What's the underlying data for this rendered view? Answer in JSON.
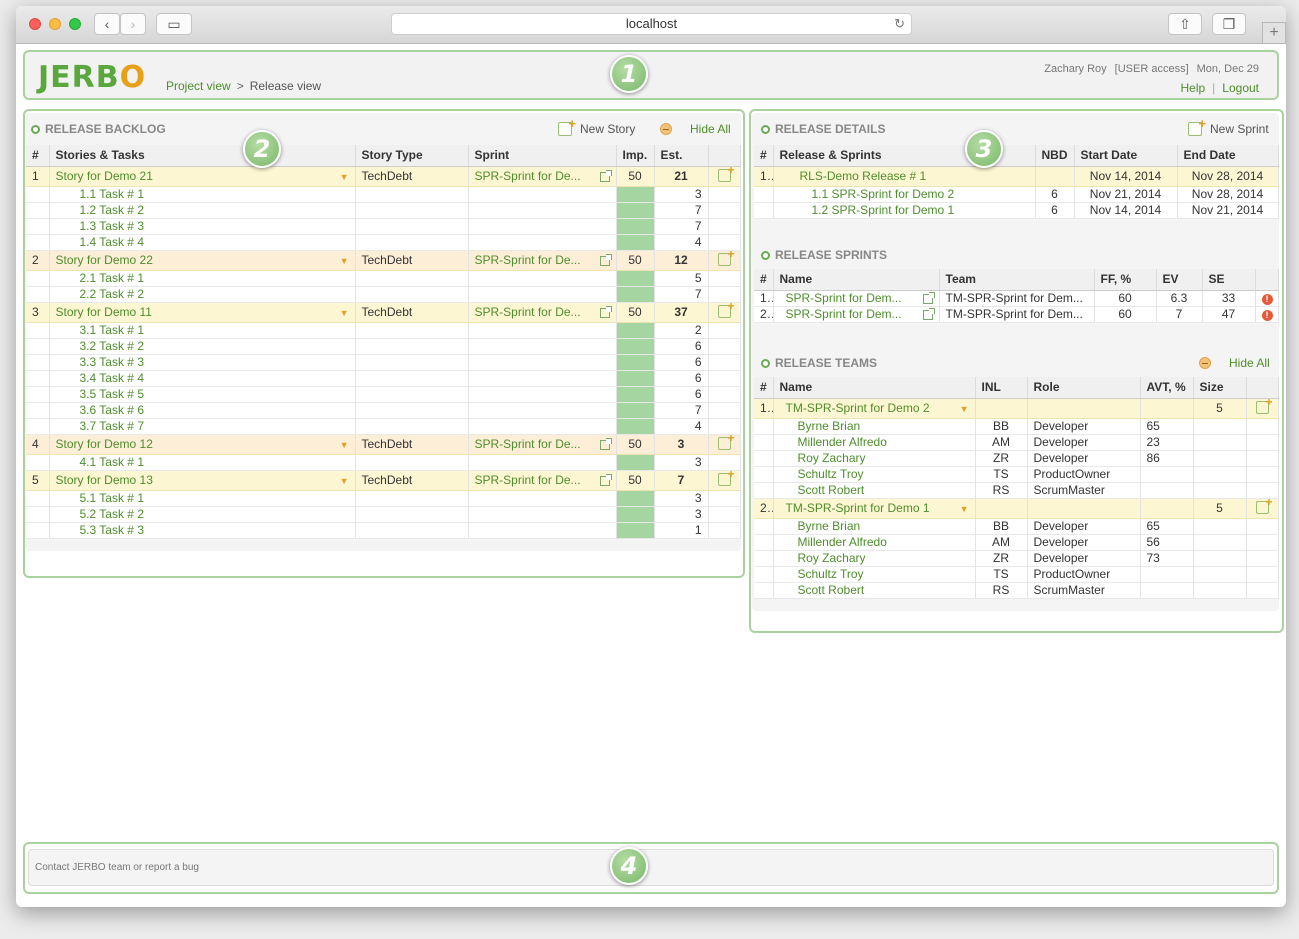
{
  "browser": {
    "url": "localhost"
  },
  "header": {
    "logo": [
      "JERB",
      "O"
    ],
    "crumbs": [
      "Project view",
      "Release view"
    ],
    "crumb_sep": ">",
    "user": "Zachary Roy",
    "access": "[USER access]",
    "date": "Mon, Dec 29",
    "help": "Help",
    "link_sep": "|",
    "logout": "Logout"
  },
  "badges": [
    "1",
    "2",
    "3",
    "4"
  ],
  "backlog": {
    "title": "RELEASE BACKLOG",
    "new_story": "New Story",
    "hide_all": "Hide All",
    "columns": [
      "#",
      "Stories & Tasks",
      "Story Type",
      "Sprint",
      "Imp.",
      "Est."
    ],
    "stories": [
      {
        "n": "1",
        "name": "Story for Demo 21",
        "type": "TechDebt",
        "sprint": "SPR-Sprint for De...",
        "imp": "50",
        "est": "21",
        "tasks": [
          {
            "name": "1.1 Task # 1",
            "est": "3"
          },
          {
            "name": "1.2 Task # 2",
            "est": "7"
          },
          {
            "name": "1.3 Task # 3",
            "est": "7"
          },
          {
            "name": "1.4 Task # 4",
            "est": "4"
          }
        ]
      },
      {
        "n": "2",
        "name": "Story for Demo 22",
        "type": "TechDebt",
        "sprint": "SPR-Sprint for De...",
        "imp": "50",
        "est": "12",
        "tasks": [
          {
            "name": "2.1 Task # 1",
            "est": "5"
          },
          {
            "name": "2.2 Task # 2",
            "est": "7"
          }
        ]
      },
      {
        "n": "3",
        "name": "Story for Demo 11",
        "type": "TechDebt",
        "sprint": "SPR-Sprint for De...",
        "imp": "50",
        "est": "37",
        "tasks": [
          {
            "name": "3.1 Task # 1",
            "est": "2"
          },
          {
            "name": "3.2 Task # 2",
            "est": "6"
          },
          {
            "name": "3.3 Task # 3",
            "est": "6"
          },
          {
            "name": "3.4 Task # 4",
            "est": "6"
          },
          {
            "name": "3.5 Task # 5",
            "est": "6"
          },
          {
            "name": "3.6 Task # 6",
            "est": "7"
          },
          {
            "name": "3.7 Task # 7",
            "est": "4"
          }
        ]
      },
      {
        "n": "4",
        "name": "Story for Demo 12",
        "type": "TechDebt",
        "sprint": "SPR-Sprint for De...",
        "imp": "50",
        "est": "3",
        "tasks": [
          {
            "name": "4.1 Task # 1",
            "est": "3"
          }
        ]
      },
      {
        "n": "5",
        "name": "Story for Demo 13",
        "type": "TechDebt",
        "sprint": "SPR-Sprint for De...",
        "imp": "50",
        "est": "7",
        "tasks": [
          {
            "name": "5.1 Task # 1",
            "est": "3"
          },
          {
            "name": "5.2 Task # 2",
            "est": "3"
          },
          {
            "name": "5.3 Task # 3",
            "est": "1"
          }
        ]
      }
    ]
  },
  "details": {
    "title": "RELEASE DETAILS",
    "new_sprint": "New Sprint",
    "columns": [
      "#",
      "Release & Sprints",
      "NBD",
      "Start Date",
      "End Date"
    ],
    "release": {
      "n": "1",
      "name": "RLS-Demo Release # 1",
      "nbd": "",
      "start": "Nov 14, 2014",
      "end": "Nov 28, 2014"
    },
    "sprints": [
      {
        "name": "1.1  SPR-Sprint for Demo 2",
        "nbd": "6",
        "start": "Nov 21, 2014",
        "end": "Nov 28, 2014"
      },
      {
        "name": "1.2  SPR-Sprint for Demo 1",
        "nbd": "6",
        "start": "Nov 14, 2014",
        "end": "Nov 21, 2014"
      }
    ]
  },
  "sprints": {
    "title": "RELEASE SPRINTS",
    "columns": [
      "#",
      "Name",
      "Team",
      "FF, %",
      "EV",
      "SE"
    ],
    "rows": [
      {
        "n": "1",
        "name": "SPR-Sprint for Dem...",
        "team": "TM-SPR-Sprint for Dem...",
        "ff": "60",
        "ev": "6.3",
        "se": "33",
        "warn": "!"
      },
      {
        "n": "2",
        "name": "SPR-Sprint for Dem...",
        "team": "TM-SPR-Sprint for Dem...",
        "ff": "60",
        "ev": "7",
        "se": "47",
        "warn": "!"
      }
    ]
  },
  "teams": {
    "title": "RELEASE TEAMS",
    "hide_all": "Hide All",
    "columns": [
      "#",
      "Name",
      "INL",
      "Role",
      "AVT, %",
      "Size"
    ],
    "groups": [
      {
        "n": "1",
        "name": "TM-SPR-Sprint for Demo 2",
        "size": "5",
        "members": [
          {
            "name": "Byrne Brian",
            "inl": "BB",
            "role": "Developer",
            "avt": "65"
          },
          {
            "name": "Millender Alfredo",
            "inl": "AM",
            "role": "Developer",
            "avt": "23"
          },
          {
            "name": "Roy Zachary",
            "inl": "ZR",
            "role": "Developer",
            "avt": "86"
          },
          {
            "name": "Schultz Troy",
            "inl": "TS",
            "role": "ProductOwner",
            "avt": ""
          },
          {
            "name": "Scott Robert",
            "inl": "RS",
            "role": "ScrumMaster",
            "avt": ""
          }
        ]
      },
      {
        "n": "2",
        "name": "TM-SPR-Sprint for Demo 1",
        "size": "5",
        "members": [
          {
            "name": "Byrne Brian",
            "inl": "BB",
            "role": "Developer",
            "avt": "65"
          },
          {
            "name": "Millender Alfredo",
            "inl": "AM",
            "role": "Developer",
            "avt": "56"
          },
          {
            "name": "Roy Zachary",
            "inl": "ZR",
            "role": "Developer",
            "avt": "73"
          },
          {
            "name": "Schultz Troy",
            "inl": "TS",
            "role": "ProductOwner",
            "avt": ""
          },
          {
            "name": "Scott Robert",
            "inl": "RS",
            "role": "ScrumMaster",
            "avt": ""
          }
        ]
      }
    ]
  },
  "footer": {
    "text": "Contact JERBO team or report a bug"
  }
}
